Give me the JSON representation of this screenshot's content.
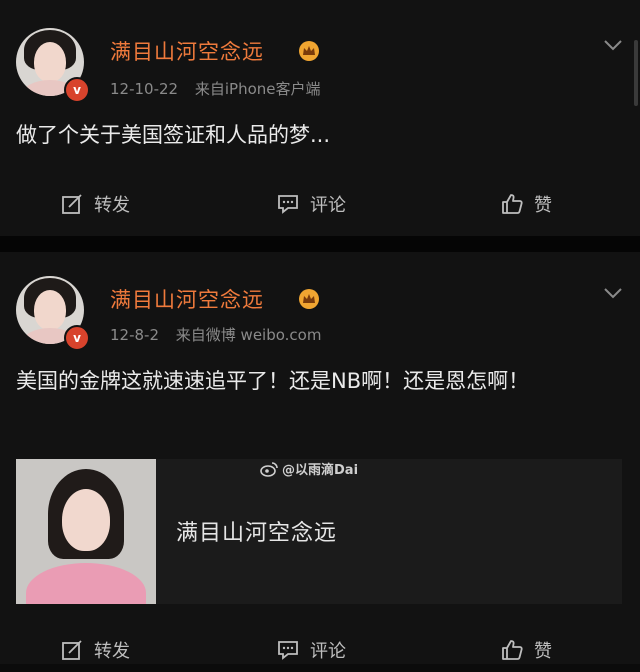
{
  "posts": [
    {
      "username": "满目山河空念远",
      "date": "12-10-22",
      "source": "来自iPhone客户端",
      "text": "做了个关于美国签证和人品的梦...",
      "actions": {
        "repost": "转发",
        "comment": "评论",
        "like": "赞"
      }
    },
    {
      "username": "满目山河空念远",
      "date": "12-8-2",
      "source": "来自微博 weibo.com",
      "text": "美国的金牌这就速速追平了！还是NB啊！还是恩怎啊！",
      "attachment": {
        "title": "满目山河空念远",
        "watermark": "@以雨滴Dai"
      },
      "actions": {
        "repost": "转发",
        "comment": "评论",
        "like": "赞"
      }
    }
  ],
  "colors": {
    "username": "#ef7a3c",
    "background": "#121212",
    "badge": "#d8432c",
    "crown": "#f0a531"
  },
  "icons": {
    "repost": "edit-share-icon",
    "comment": "comment-bubble-icon",
    "like": "thumbs-up-icon",
    "more": "chevron-down-icon",
    "badge": "verified-badge-icon",
    "member": "crown-icon"
  }
}
